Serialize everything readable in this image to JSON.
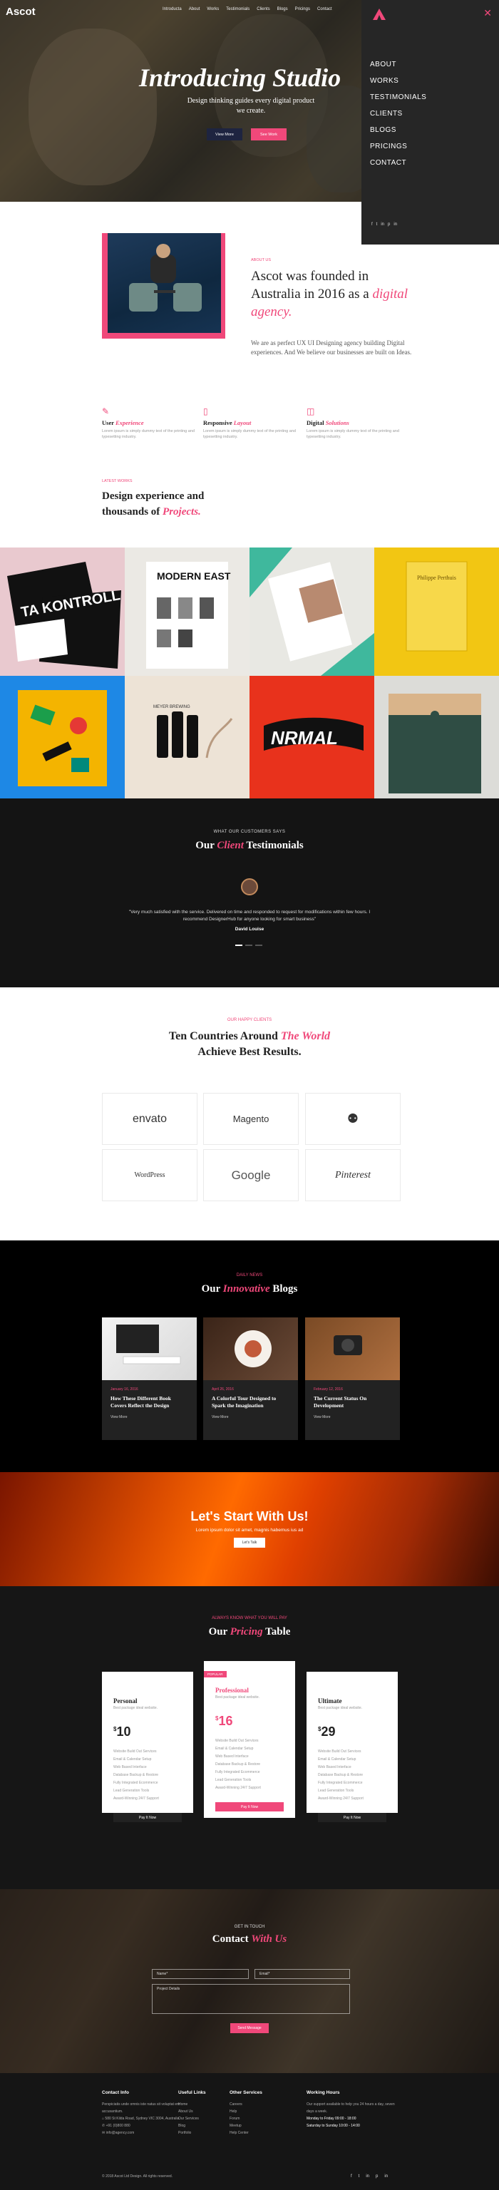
{
  "header": {
    "logo": "Ascot",
    "nav": [
      "Introducta",
      "About",
      "Works",
      "Testimonials",
      "Clients",
      "Blogs",
      "Pricings",
      "Contact"
    ]
  },
  "hero": {
    "title": "Introducing Studio",
    "subtitle": "Design thinking guides every digital product we create.",
    "btn_view": "View More",
    "btn_more": "See Work"
  },
  "sidemenu": {
    "close": "✕",
    "items": [
      "ABOUT",
      "WORKS",
      "TESTIMONIALS",
      "CLIENTS",
      "BLOGS",
      "PRICINGS",
      "CONTACT"
    ],
    "social": [
      "f",
      "t",
      "in",
      "p",
      "in"
    ]
  },
  "about": {
    "label": "ABOUT US",
    "title_a": "Ascot was founded in Australia in 2016 as a",
    "title_b": "digital agency.",
    "text": "We are as perfect UX UI Designing agency building Digital experiences. And We believe our businesses are built on Ideas."
  },
  "features": [
    {
      "icon": "✎",
      "a": "User",
      "b": "Experience",
      "desc": "Lorem ipsum is simply dummy text of the printing and typesetting industry."
    },
    {
      "icon": "▯",
      "a": "Responsive",
      "b": "Layout",
      "desc": "Lorem ipsum is simply dummy text of the printing and typesetting industry."
    },
    {
      "icon": "◫",
      "a": "Digital",
      "b": "Solutions",
      "desc": "Lorem ipsum is simply dummy text of the printing and typesetting industry."
    }
  ],
  "works": {
    "label": "LATEST WORKS",
    "title_a": "Design experience and",
    "title_b": "thousands of",
    "title_c": "Projects."
  },
  "portfolio": [
    {
      "text": "TA KONTROLL"
    },
    {
      "text": "MODERN EAST"
    },
    {
      "text": ""
    },
    {
      "text": "Philippe Perthuis"
    },
    {
      "text": ""
    },
    {
      "text": "MEYER BREWING"
    },
    {
      "text": "NRMAL"
    },
    {
      "text": ""
    }
  ],
  "testimonials": {
    "label": "WHAT OUR CUSTOMERS SAYS",
    "title_a": "Our",
    "title_b": "Client",
    "title_c": "Testimonials",
    "quote": "\"Very much satisfied with the service. Delivered on time and responded to request for modifications within few hours. I recommend DesignerHub for anyone looking for smart business\"",
    "name": "David Louise"
  },
  "clients": {
    "label": "OUR HAPPY CLIENTS",
    "title_a": "Ten Countries Around",
    "title_b": "The World",
    "title_c": "Achieve Best Results.",
    "logos": [
      "envato",
      "Magento",
      "⚉",
      "WordPress",
      "Google",
      "Pinterest"
    ]
  },
  "blogs": {
    "label": "DAILY NEWS",
    "title_a": "Our",
    "title_b": "Innovative",
    "title_c": "Blogs",
    "items": [
      {
        "date": "January 16, 2016",
        "title": "How These Different Book Covers Reflect the Design",
        "more": "View More"
      },
      {
        "date": "April 26, 2016",
        "title": "A Colorful Tour Designed to Spark the Imagination",
        "more": "View More"
      },
      {
        "date": "February 12, 2016",
        "title": "The Current Status On Development",
        "more": "View More"
      }
    ]
  },
  "cta": {
    "title": "Let's Start With Us!",
    "sub": "Lorem ipsum dolor sit amet, magnis habemus ius ad",
    "btn": "Let's Talk"
  },
  "pricing": {
    "label": "ALWAYS KNOW WHAT YOU WILL PAY",
    "title_a": "Our",
    "title_b": "Pricing",
    "title_c": "Table",
    "plans": [
      {
        "name": "Personal",
        "desc": "Best package ideal website.",
        "price": "10",
        "features": [
          "Website Build Out Services",
          "Email & Calendar Setup",
          "Web Based Interface",
          "Database Backup & Restore",
          "Fully Integrated Ecommerce",
          "Lead Generation Tools",
          "Award-Winning 24/7 Support"
        ],
        "btn": "Pay It Now"
      },
      {
        "name": "Professional",
        "desc": "Best package ideal website.",
        "price": "16",
        "ribbon": "POPULAR",
        "features": [
          "Website Build Out Services",
          "Email & Calendar Setup",
          "Web Based Interface",
          "Database Backup & Restore",
          "Fully Integrated Ecommerce",
          "Lead Generation Tools",
          "Award-Winning 24/7 Support"
        ],
        "btn": "Pay It Now"
      },
      {
        "name": "Ultimate",
        "desc": "Best package ideal website.",
        "price": "29",
        "features": [
          "Website Build Out Services",
          "Email & Calendar Setup",
          "Web Based Interface",
          "Database Backup & Restore",
          "Fully Integrated Ecommerce",
          "Lead Generation Tools",
          "Award-Winning 24/7 Support"
        ],
        "btn": "Pay It Now"
      }
    ]
  },
  "contact": {
    "label": "GET IN TOUCH",
    "title_a": "Contact",
    "title_b": "With Us",
    "name_ph": "Name*",
    "email_ph": "Email*",
    "message_ph": "Project Details",
    "btn": "Send Message"
  },
  "footer": {
    "cols": [
      {
        "head": "Contact Info",
        "lines": [
          "Perspiciatis unde omnis iste natus sit voluptat em accusantium.",
          "⌂  580 St Kilda Road, Sydney VIC 3004, Australia",
          "✆  +91 (0)800 880",
          "✉  info@agency.com"
        ]
      },
      {
        "head": "Useful Links",
        "lines": [
          "Home",
          "About Us",
          "Our Services",
          "Blog",
          "Portfolio"
        ]
      },
      {
        "head": "Other Services",
        "lines": [
          "Careers",
          "Help",
          "Forum",
          "Meetup",
          "Help Center"
        ]
      },
      {
        "head": "Working Hours",
        "lines": [
          "Our support available to help you 24 hours a day, seven days a week.",
          "Monday to Friday  09:00 - 18:00",
          "Saturday to Sunday  10:00 - 14:00"
        ]
      }
    ],
    "copy": "© 2018 Ascot Ltd Design. All rights reserved.",
    "social": [
      "f",
      "t",
      "in",
      "p",
      "in"
    ]
  },
  "colors": {
    "accent": "#f0487a",
    "dark": "#141414",
    "navy_button": "#1e2440"
  }
}
